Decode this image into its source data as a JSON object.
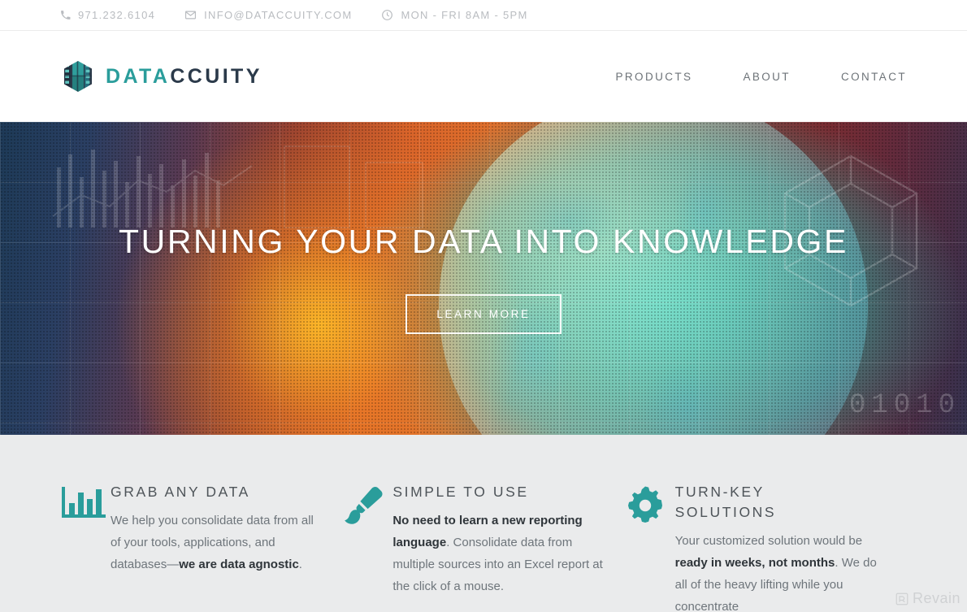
{
  "topbar": {
    "items": [
      {
        "icon": "phone-icon",
        "text": "971.232.6104"
      },
      {
        "icon": "mail-icon",
        "text": "INFO@DATACCUITY.COM"
      },
      {
        "icon": "clock-icon",
        "text": "MON - FRI 8AM - 5PM"
      }
    ]
  },
  "header": {
    "logo": {
      "part1": "DATA",
      "part2": "CCUITY",
      "icon": "hexagon-cube-logo-icon"
    },
    "nav": [
      {
        "label": "PRODUCTS"
      },
      {
        "label": "ABOUT"
      },
      {
        "label": "CONTACT"
      }
    ]
  },
  "hero": {
    "title": "TURNING YOUR DATA INTO KNOWLEDGE",
    "button_label": "LEARN MORE",
    "binary_text": "01010"
  },
  "features": [
    {
      "icon": "bar-chart-icon",
      "title": "GRAB ANY DATA",
      "text_before": "We help you consolidate data from all of your tools, applications, and databases—",
      "text_bold": "we are data agnostic",
      "text_after": "."
    },
    {
      "icon": "paintbrush-icon",
      "title": "SIMPLE TO USE",
      "text_before": "",
      "text_bold": "No need to learn a new reporting language",
      "text_after": ". Consolidate data from multiple sources into an Excel report at the click of a mouse."
    },
    {
      "icon": "gear-icon",
      "title": "TURN-KEY\nSOLUTIONS",
      "text_before": "Your customized solution would be ",
      "text_bold": "ready in weeks, not months",
      "text_after": ". We do all of the heavy lifting while you concentrate"
    }
  ],
  "watermark": {
    "label": "Revain"
  },
  "colors": {
    "teal": "#2a9d9b",
    "navy": "#2b3a4a",
    "features_bg": "#eaebec",
    "body_text": "#6e757b",
    "heading_text": "#4e5459",
    "topbar_text": "#b9bcc0"
  }
}
